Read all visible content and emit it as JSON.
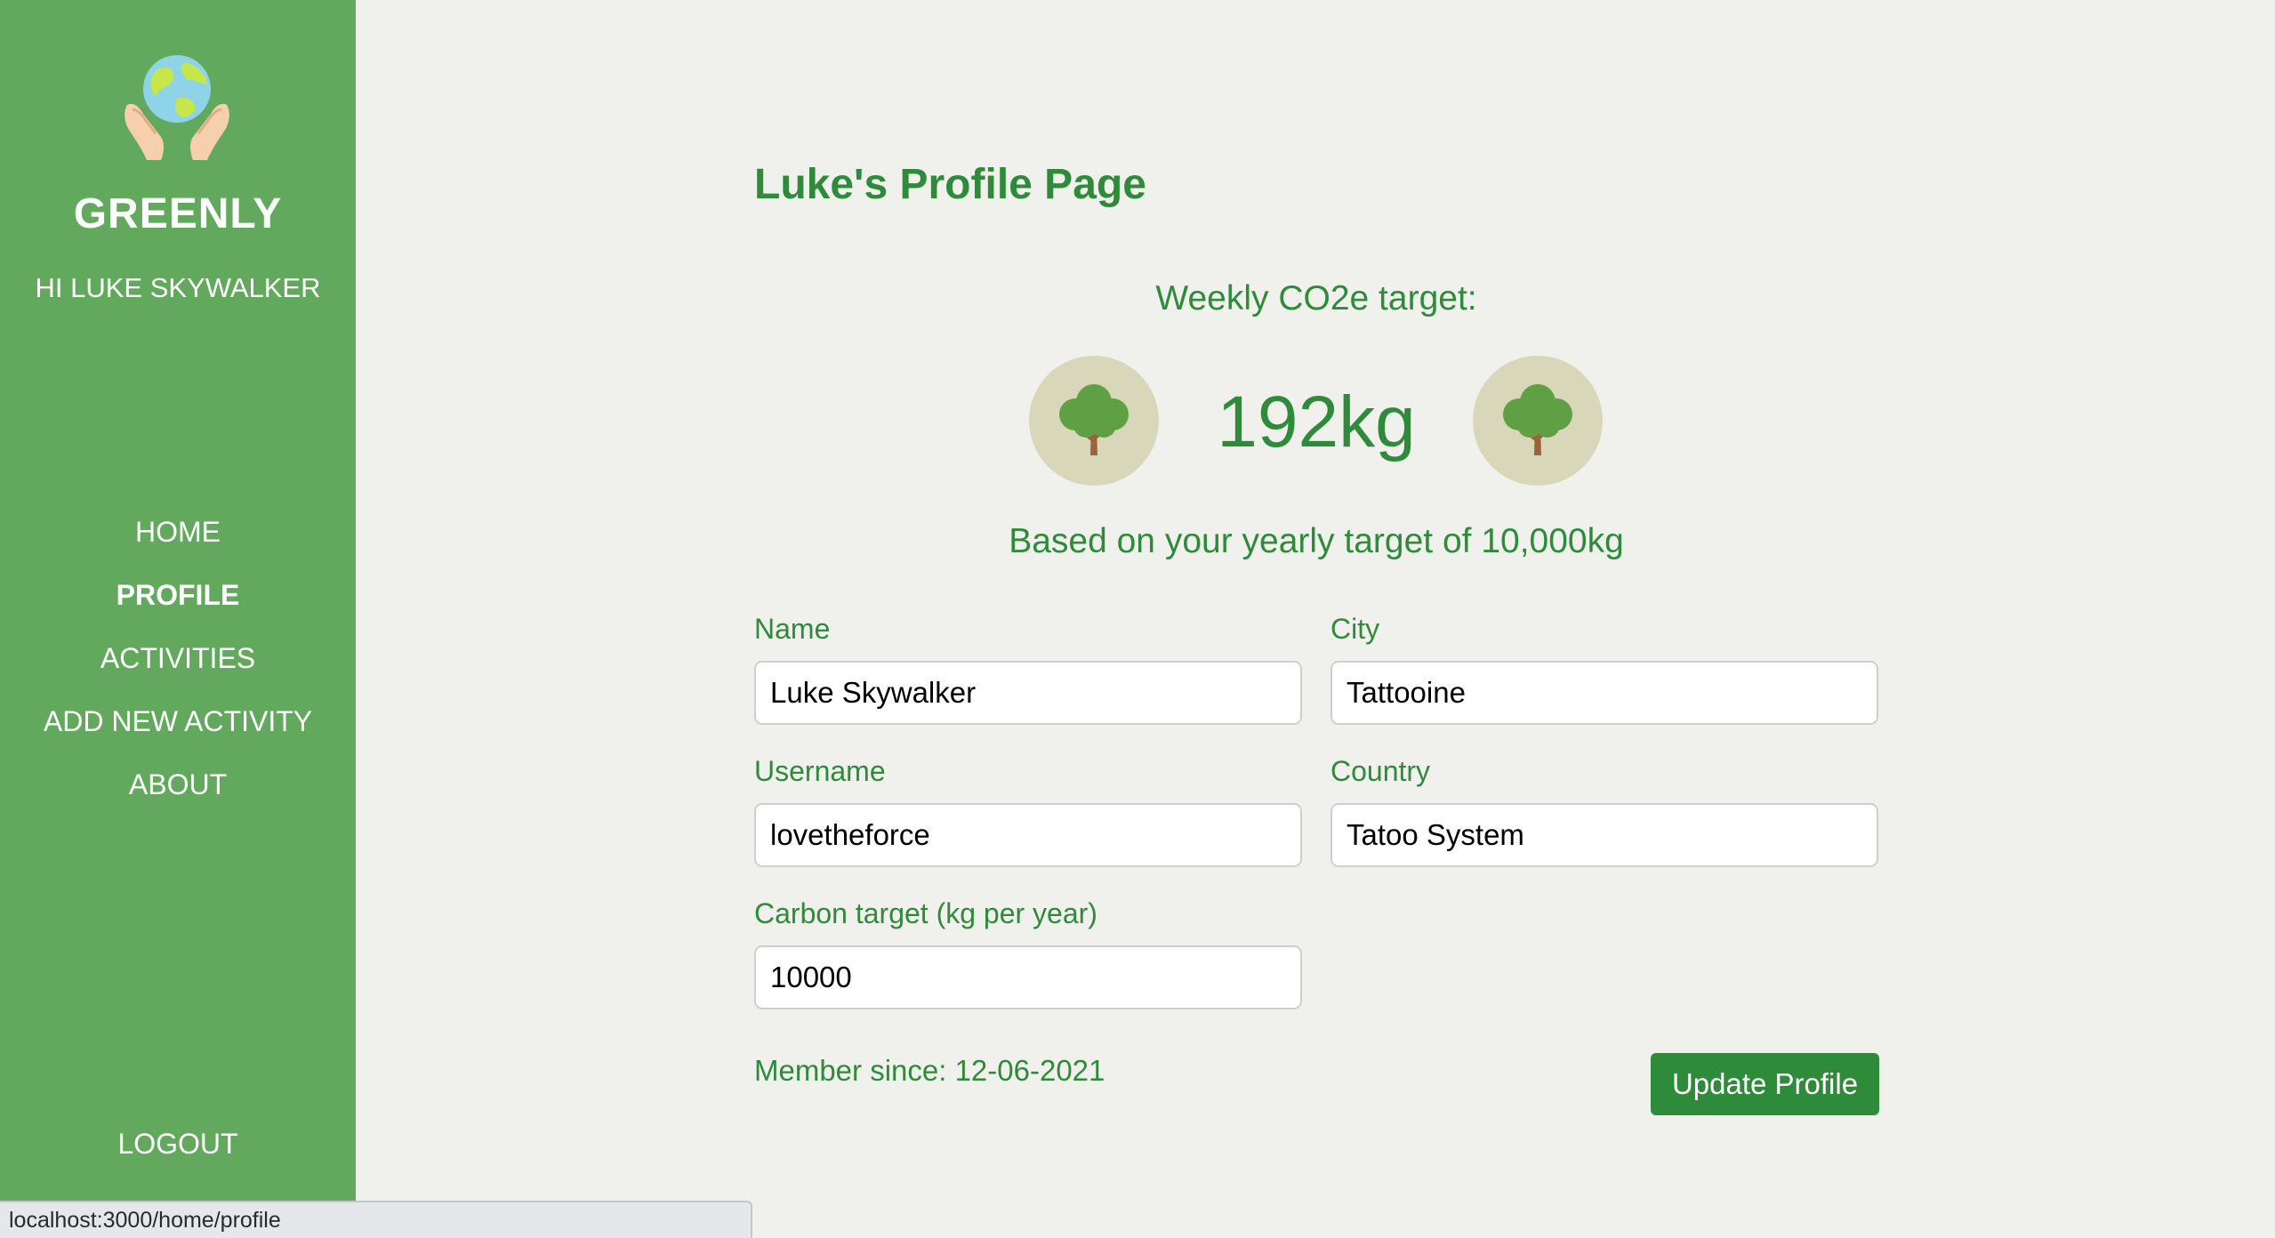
{
  "sidebar": {
    "logo_icon": "earth-in-hands-icon",
    "brand": "GREENLY",
    "greeting": "HI LUKE SKYWALKER",
    "nav": {
      "home": "HOME",
      "profile": "PROFILE",
      "activities": "ACTIVITIES",
      "add_activity": "ADD NEW ACTIVITY",
      "about": "ABOUT"
    },
    "logout": "LOGOUT",
    "active_item": "PROFILE"
  },
  "main": {
    "title": "Luke's Profile Page",
    "weekly_label": "Weekly CO2e target:",
    "weekly_value": "192kg",
    "tree_icon": "tree-icon",
    "yearly_note": "Based on your yearly target of 10,000kg",
    "form": {
      "name_label": "Name",
      "name_value": "Luke Skywalker",
      "city_label": "City",
      "city_value": "Tattooine",
      "username_label": "Username",
      "username_value": "lovetheforce",
      "country_label": "Country",
      "country_value": "Tatoo System",
      "carbon_label": "Carbon target (kg per year)",
      "carbon_value": "10000"
    },
    "member_since": "Member since: 12-06-2021",
    "update_button": "Update Profile"
  },
  "status_bar": {
    "url": "localhost:3000/home/profile"
  },
  "colors": {
    "sidebar_bg": "#62a95e",
    "accent": "#2e8b3a",
    "page_bg": "#f0f0ec",
    "tree_badge_bg": "#d9d7b9"
  }
}
